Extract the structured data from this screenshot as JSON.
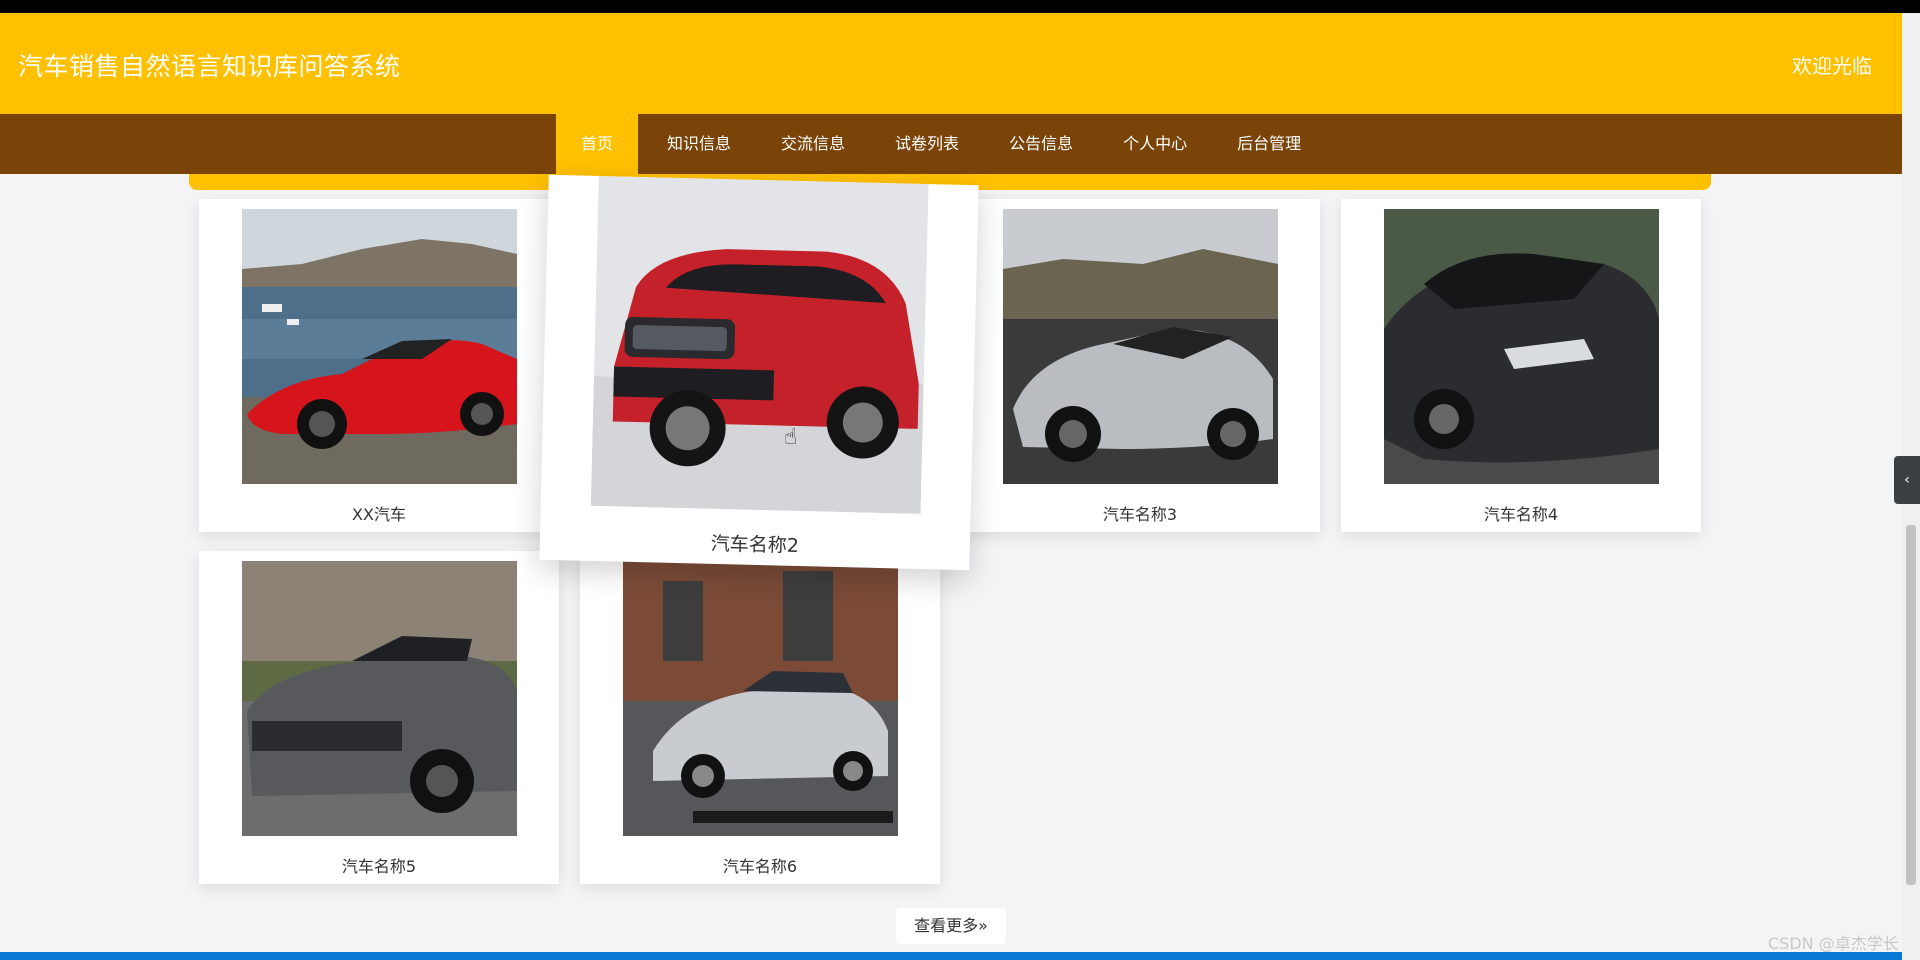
{
  "header": {
    "title": "汽车销售自然语言知识库问答系统",
    "welcome": "欢迎光临"
  },
  "nav": {
    "items": [
      {
        "label": "首页",
        "active": true
      },
      {
        "label": "知识信息"
      },
      {
        "label": "交流信息"
      },
      {
        "label": "试卷列表"
      },
      {
        "label": "公告信息"
      },
      {
        "label": "个人中心"
      },
      {
        "label": "后台管理"
      }
    ]
  },
  "cars": [
    {
      "name": "XX汽车",
      "scene": "red-convertible-sea"
    },
    {
      "name": "汽车名称2",
      "scene": "red-suv"
    },
    {
      "name": "汽车名称3",
      "scene": "silver-supercar"
    },
    {
      "name": "汽车名称4",
      "scene": "dark-sports-car"
    },
    {
      "name": "汽车名称5",
      "scene": "gray-muscle-car"
    },
    {
      "name": "汽车名称6",
      "scene": "silver-sedan"
    }
  ],
  "more_button": {
    "label": "查看更多",
    "icon": "double-chevron-right-icon"
  },
  "watermark": "CSDN @卓杰学长",
  "colors": {
    "brand": "#ffc000",
    "nav": "#7a4408",
    "accent": "#0a79d4"
  }
}
